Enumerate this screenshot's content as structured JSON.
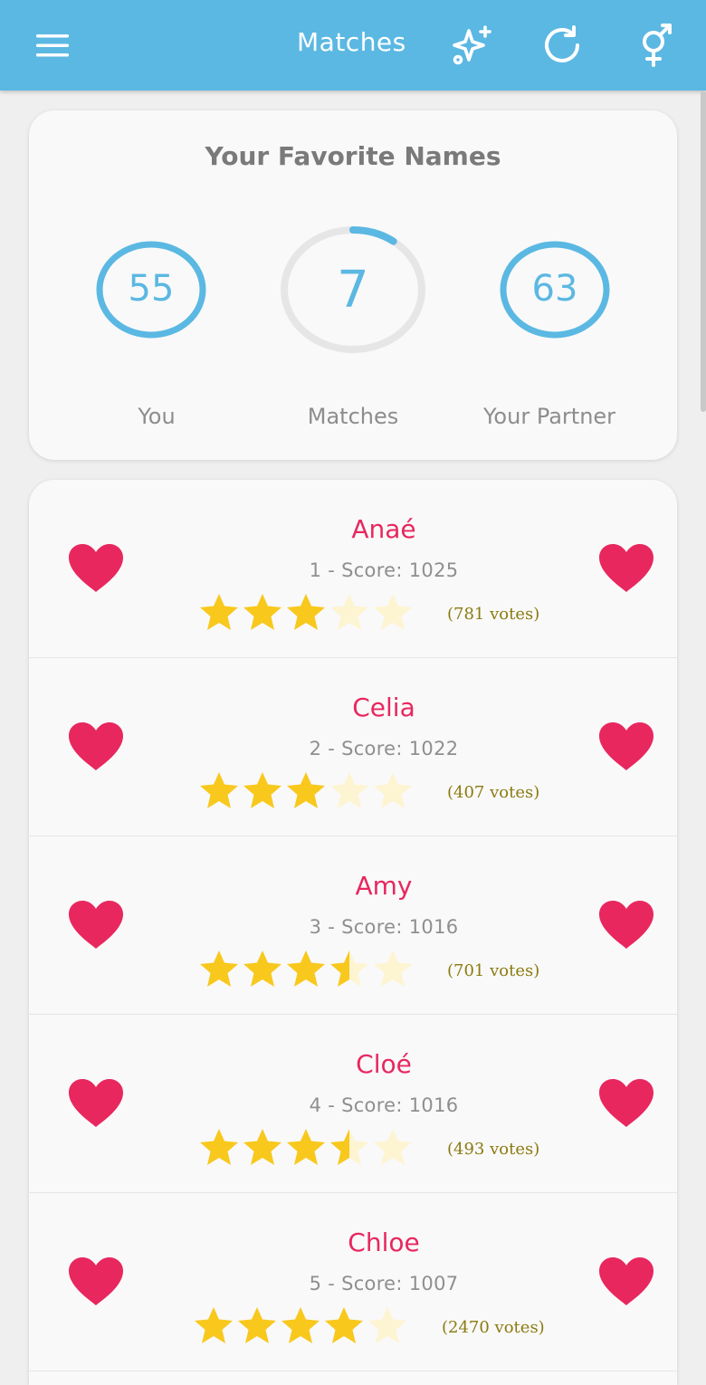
{
  "app": {
    "title": "Matches",
    "icons": [
      "menu-icon",
      "sparkles-icon",
      "refresh-icon",
      "gender-icon"
    ],
    "accent_color": "#5bb8e2",
    "name_color": "#e8275f"
  },
  "summary": {
    "title": "Your Favorite Names",
    "you": {
      "count": "55",
      "label": "You"
    },
    "matches": {
      "count": "7",
      "label": "Matches",
      "progress": 0.1
    },
    "partner": {
      "count": "63",
      "label": "Your Partner"
    }
  },
  "names": [
    {
      "name": "Anaé",
      "score_text": "1 - Score: 1025",
      "rating": 3.0,
      "votes": "(781 votes)"
    },
    {
      "name": "Celia",
      "score_text": "2 - Score: 1022",
      "rating": 3.0,
      "votes": "(407 votes)"
    },
    {
      "name": "Amy",
      "score_text": "3 - Score: 1016",
      "rating": 3.5,
      "votes": "(701 votes)"
    },
    {
      "name": "Cloé",
      "score_text": "4 - Score: 1016",
      "rating": 3.5,
      "votes": "(493 votes)"
    },
    {
      "name": "Chloe",
      "score_text": "5 - Score: 1007",
      "rating": 4.0,
      "votes": "(2470 votes)"
    }
  ]
}
